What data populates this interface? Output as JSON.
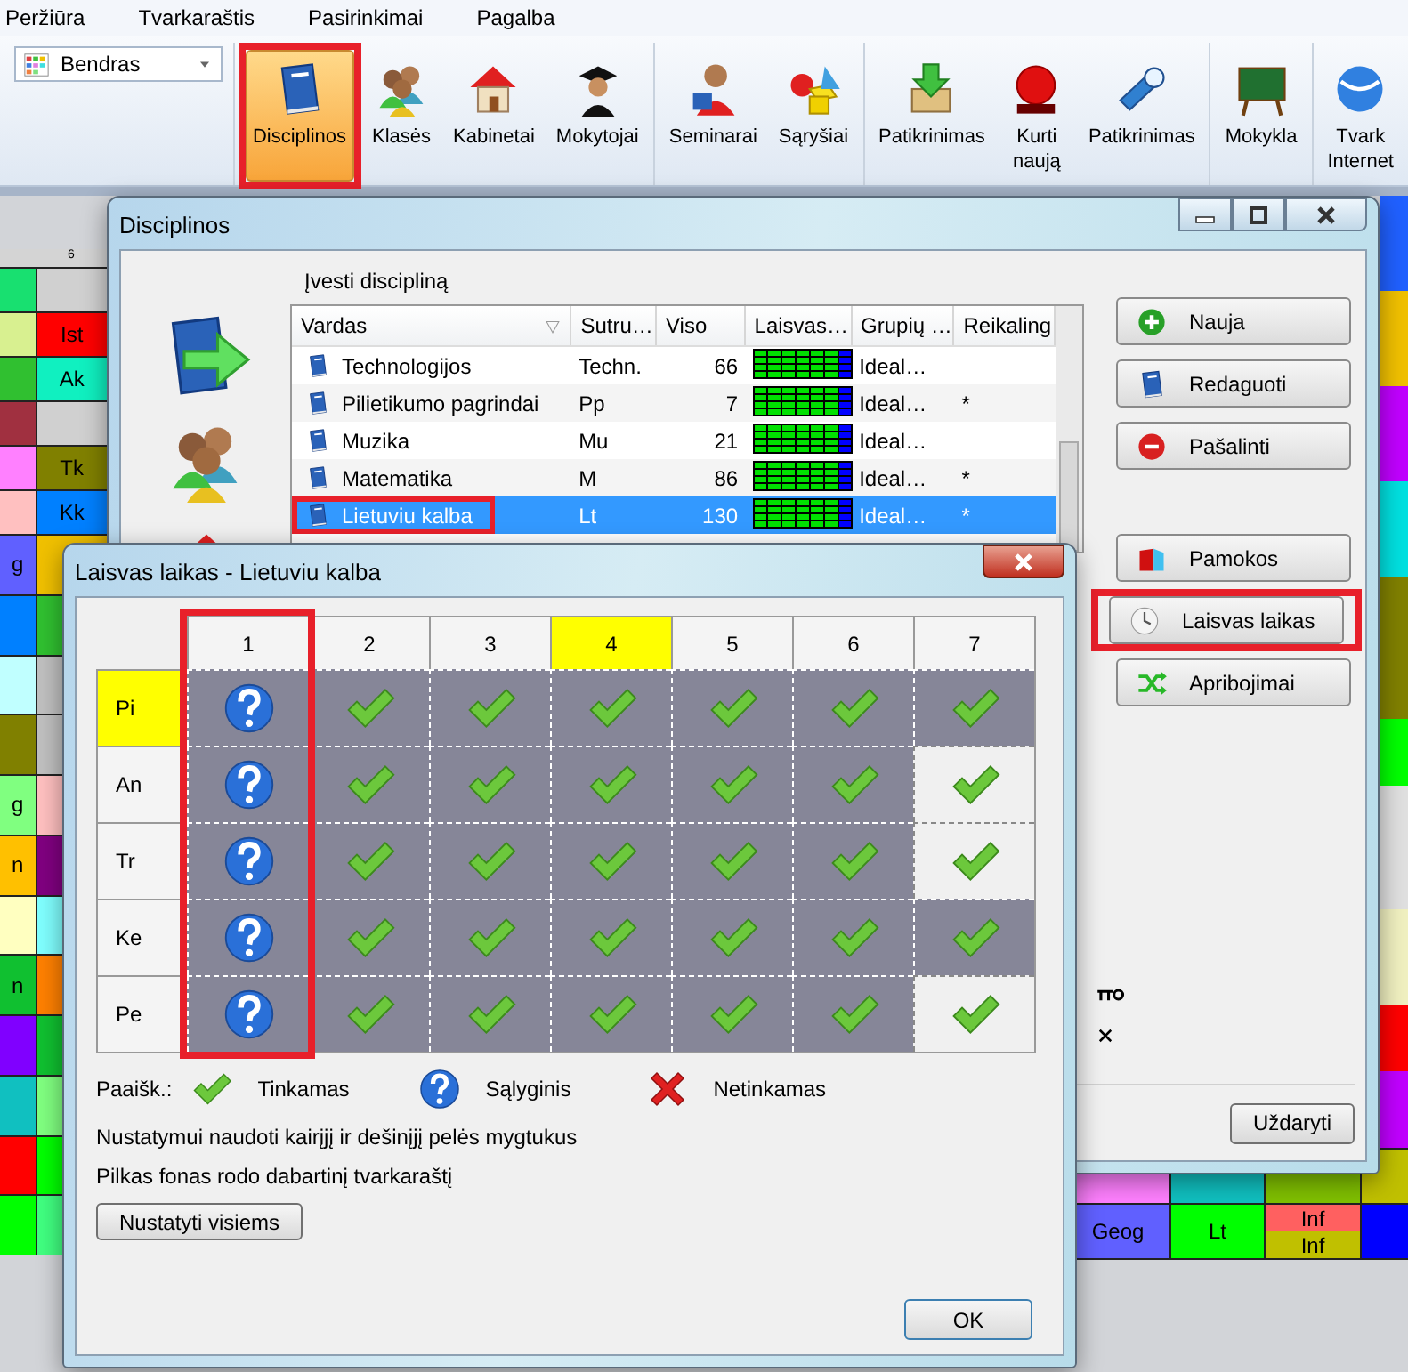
{
  "menu": [
    {
      "label": "Peržiūra"
    },
    {
      "label": "Tvarkaraštis"
    },
    {
      "label": "Pasirinkimai"
    },
    {
      "label": "Pagalba"
    }
  ],
  "ribbon": {
    "view_select": {
      "value": "Bendras"
    },
    "groups": [
      {
        "buttons": [
          {
            "label": "Disciplinos",
            "selected": true,
            "highlighted": true
          },
          {
            "label": "Klasės",
            "selected": false,
            "highlighted": false
          },
          {
            "label": "Kabinetai",
            "selected": false,
            "highlighted": false
          },
          {
            "label": "Mokytojai",
            "selected": false,
            "highlighted": false
          }
        ]
      },
      {
        "buttons": [
          {
            "label": "Seminarai",
            "selected": false,
            "highlighted": false
          },
          {
            "label": "Sąryšiai",
            "selected": false,
            "highlighted": false
          }
        ]
      },
      {
        "buttons": [
          {
            "label": "Patikrinimas",
            "selected": false,
            "highlighted": false
          },
          {
            "label": "Kurti\nnaują",
            "selected": false,
            "highlighted": false
          },
          {
            "label": "Patikrinimas",
            "selected": false,
            "highlighted": false
          }
        ]
      },
      {
        "buttons": [
          {
            "label": "Mokykla",
            "selected": false,
            "highlighted": false
          }
        ]
      },
      {
        "buttons": [
          {
            "label": "Tvark\nInternet",
            "selected": false,
            "highlighted": false
          }
        ]
      }
    ]
  },
  "background_timetable": {
    "header": "6",
    "left_rows": [
      {
        "cells": [
          {
            "color": "#18e070"
          },
          {
            "color": "#d0d0d0"
          }
        ]
      },
      {
        "cells": [
          {
            "color": "#d8f090"
          },
          {
            "color": "#ff0000",
            "text": "Ist"
          }
        ]
      },
      {
        "cells": [
          {
            "color": "#30c030"
          },
          {
            "color": "#10f0c0",
            "text": "Ak"
          }
        ]
      },
      {
        "cells": [
          {
            "color": "#a03040"
          },
          {
            "color": "#d0d0d0"
          }
        ]
      },
      {
        "cells": [
          {
            "color": "#ff80ff"
          },
          {
            "color": "#808000",
            "text": "Tk"
          }
        ]
      },
      {
        "cells": [
          {
            "color": "#ffc0c0"
          },
          {
            "color": "#0080ff",
            "text": "Kk"
          }
        ]
      },
      {
        "cells": [
          {
            "color": "#6060ff",
            "text": "g"
          },
          {
            "color": "#f0c000"
          }
        ]
      },
      {
        "cells": [
          {
            "color": "#0080ff"
          },
          {
            "color": "#30c030"
          }
        ]
      },
      {
        "cells": [
          {
            "color": "#c0ffff"
          },
          {
            "color": "#c0c0c0"
          }
        ]
      },
      {
        "cells": [
          {
            "color": "#808000"
          },
          {
            "color": "#c0c0c0"
          }
        ]
      },
      {
        "cells": [
          {
            "color": "#80ff80",
            "text": "g"
          },
          {
            "color": "#ffc0c0"
          }
        ]
      },
      {
        "cells": [
          {
            "color": "#ffc000",
            "text": "n"
          },
          {
            "color": "#800080"
          }
        ]
      },
      {
        "cells": [
          {
            "color": "#ffffc0"
          },
          {
            "color": "#80ffff"
          }
        ]
      },
      {
        "cells": [
          {
            "color": "#10c030",
            "text": "n"
          },
          {
            "color": "#ff8000"
          }
        ]
      },
      {
        "cells": [
          {
            "color": "#8000ff"
          },
          {
            "color": "#10c030"
          }
        ]
      },
      {
        "cells": [
          {
            "color": "#10c0c0"
          },
          {
            "color": "#80ff80"
          }
        ]
      },
      {
        "cells": [
          {
            "color": "#ff0000"
          },
          {
            "color": "#00ff00"
          }
        ]
      },
      {
        "cells": [
          {
            "color": "#00ff00"
          },
          {
            "color": "#40ff80"
          }
        ]
      }
    ],
    "bottom_rows": [
      {
        "cells": [
          {
            "color": "#ff80ff"
          },
          {
            "color": "#10c0c0"
          },
          {
            "color": "#80c000"
          },
          {
            "color": "#c0c000"
          }
        ]
      },
      {
        "cells": [
          {
            "color": "#6060ff",
            "text": "Geog"
          },
          {
            "color": "#00ff00",
            "text": "Lt"
          },
          {
            "parts": [
              {
                "color": "#ff6060",
                "text": "Inf"
              },
              {
                "color": "#c0c000",
                "text": "Inf"
              }
            ]
          },
          {
            "color": "#0000ff"
          }
        ]
      }
    ]
  },
  "disciplines_window": {
    "title": "Disciplinos",
    "list_label": "Įvesti discipliną",
    "columns": [
      {
        "label": "Vardas"
      },
      {
        "label": "Sutru…"
      },
      {
        "label": "Viso"
      },
      {
        "label": "Laisvas…"
      },
      {
        "label": "Grupių …"
      },
      {
        "label": "Reikaling"
      }
    ],
    "rows": [
      {
        "name": "Technologijos",
        "short": "Techn.",
        "total": "66",
        "grouping": "Ideal…",
        "selected": false,
        "highlighted": false
      },
      {
        "name": "Pilietikumo pagrindai",
        "short": "Pp",
        "total": "7",
        "grouping": "Ideal…",
        "required": "*",
        "selected": false,
        "highlighted": false
      },
      {
        "name": "Muzika",
        "short": "Mu",
        "total": "21",
        "grouping": "Ideal…",
        "selected": false,
        "highlighted": false
      },
      {
        "name": "Matematika",
        "short": "M",
        "total": "86",
        "grouping": "Ideal…",
        "required": "*",
        "selected": false,
        "highlighted": false
      },
      {
        "name": "Lietuviu kalba",
        "short": "Lt",
        "total": "130",
        "grouping": "Ideal…",
        "required": "*",
        "selected": true,
        "highlighted": true
      }
    ],
    "buttons": [
      {
        "label": "Nauja",
        "highlighted": false
      },
      {
        "label": "Redaguoti",
        "highlighted": false
      },
      {
        "label": "Pašalinti",
        "highlighted": false
      }
    ],
    "buttons2": [
      {
        "label": "Pamokos",
        "highlighted": false
      },
      {
        "label": "Laisvas laikas",
        "highlighted": true
      },
      {
        "label": "Apribojimai",
        "highlighted": false
      }
    ],
    "close_button": "Uždaryti"
  },
  "free_time_dialog": {
    "title": "Laisvas laikas - Lietuviu kalba",
    "columns": [
      {
        "label": "1",
        "selected": false,
        "highlighted": true
      },
      {
        "label": "2",
        "selected": false,
        "highlighted": false
      },
      {
        "label": "3",
        "selected": false,
        "highlighted": false
      },
      {
        "label": "4",
        "selected": true,
        "highlighted": false
      },
      {
        "label": "5",
        "selected": false,
        "highlighted": false
      },
      {
        "label": "6",
        "selected": false,
        "highlighted": false
      },
      {
        "label": "7",
        "selected": false,
        "highlighted": false
      }
    ],
    "rows": [
      {
        "label": "Pi",
        "selected": true,
        "cells": [
          {
            "kind": "maybe",
            "busy": true
          },
          {
            "kind": "ok",
            "busy": true
          },
          {
            "kind": "ok",
            "busy": true
          },
          {
            "kind": "ok",
            "busy": true
          },
          {
            "kind": "ok",
            "busy": true
          },
          {
            "kind": "ok",
            "busy": true
          },
          {
            "kind": "ok",
            "busy": true
          }
        ]
      },
      {
        "label": "An",
        "selected": false,
        "cells": [
          {
            "kind": "maybe",
            "busy": true
          },
          {
            "kind": "ok",
            "busy": true
          },
          {
            "kind": "ok",
            "busy": true
          },
          {
            "kind": "ok",
            "busy": true
          },
          {
            "kind": "ok",
            "busy": true
          },
          {
            "kind": "ok",
            "busy": true
          },
          {
            "kind": "ok",
            "busy": false
          }
        ]
      },
      {
        "label": "Tr",
        "selected": false,
        "cells": [
          {
            "kind": "maybe",
            "busy": true
          },
          {
            "kind": "ok",
            "busy": true
          },
          {
            "kind": "ok",
            "busy": true
          },
          {
            "kind": "ok",
            "busy": true
          },
          {
            "kind": "ok",
            "busy": true
          },
          {
            "kind": "ok",
            "busy": true
          },
          {
            "kind": "ok",
            "busy": false
          }
        ]
      },
      {
        "label": "Ke",
        "selected": false,
        "cells": [
          {
            "kind": "maybe",
            "busy": true
          },
          {
            "kind": "ok",
            "busy": true
          },
          {
            "kind": "ok",
            "busy": true
          },
          {
            "kind": "ok",
            "busy": true
          },
          {
            "kind": "ok",
            "busy": true
          },
          {
            "kind": "ok",
            "busy": true
          },
          {
            "kind": "ok",
            "busy": true
          }
        ]
      },
      {
        "label": "Pe",
        "selected": false,
        "cells": [
          {
            "kind": "maybe",
            "busy": true
          },
          {
            "kind": "ok",
            "busy": true
          },
          {
            "kind": "ok",
            "busy": true
          },
          {
            "kind": "ok",
            "busy": true
          },
          {
            "kind": "ok",
            "busy": true
          },
          {
            "kind": "ok",
            "busy": true
          },
          {
            "kind": "ok",
            "busy": false
          }
        ]
      }
    ],
    "legend_label": "Paaišk.:",
    "legend": [
      {
        "kind": "ok",
        "label": "Tinkamas"
      },
      {
        "kind": "maybe",
        "label": "Sąlyginis"
      },
      {
        "kind": "no",
        "label": "Netinkamas"
      }
    ],
    "notes": [
      "Nustatymui naudoti kairįjį ir dešinįjį pelės mygtukus",
      "Pilkas fonas rodo dabartinį tvarkaraštį"
    ],
    "set_all_button": "Nustatyti visiems",
    "ok_button": "OK"
  }
}
